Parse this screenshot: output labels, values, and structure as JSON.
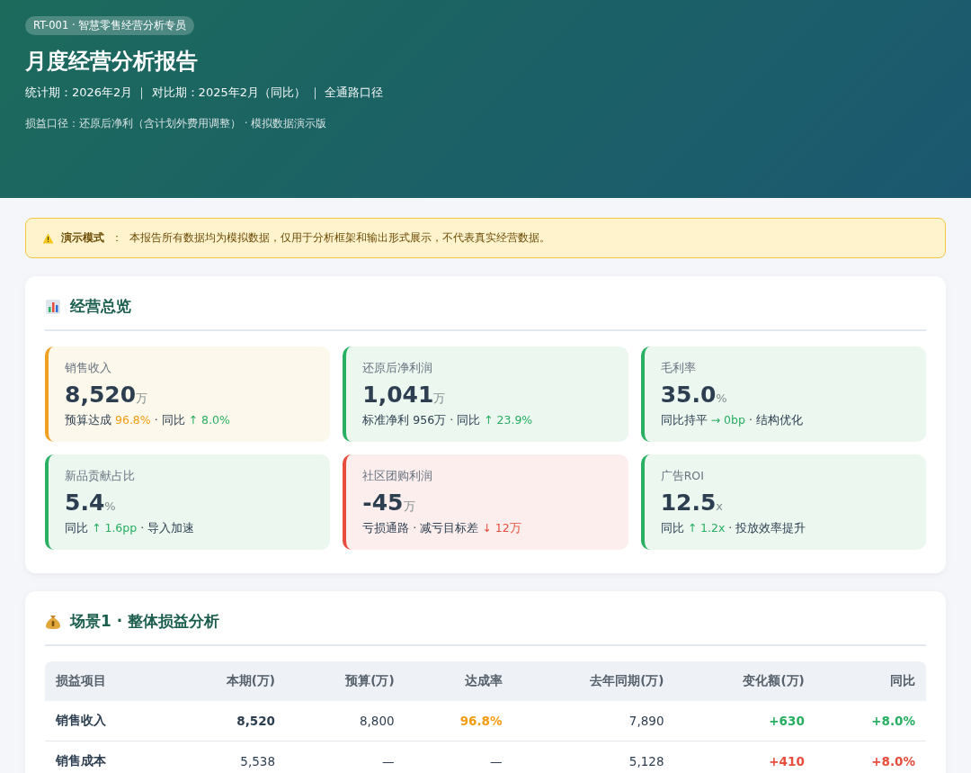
{
  "header": {
    "badge": "RT-001 · 智慧零售经营分析专员",
    "title": "月度经营分析报告",
    "meta": "统计期：2026年2月 ｜ 对比期：2025年2月（同比） ｜ 全通路口径",
    "note": "损益口径：还原后净利（含计划外费用调整） · 模拟数据演示版"
  },
  "notice": {
    "label": "演示模式",
    "separator": "：",
    "text": "本报告所有数据均为模拟数据，仅用于分析框架和输出形式展示，不代表真实经营数据。"
  },
  "overview": {
    "title": "经营总览",
    "cards": [
      {
        "kind": "warning",
        "label": "销售收入",
        "value": "8,520",
        "unit": "万",
        "sub": [
          {
            "text": "预算达成 ",
            "kind": "plain"
          },
          {
            "text": "96.8%",
            "kind": "warning"
          },
          {
            "text": " · 同比 ",
            "kind": "plain"
          },
          {
            "text": "↑ 8.0%",
            "kind": "positive"
          }
        ]
      },
      {
        "kind": "good",
        "label": "还原后净利润",
        "value": "1,041",
        "unit": "万",
        "sub": [
          {
            "text": "标准净利 956万 · 同比 ",
            "kind": "plain"
          },
          {
            "text": "↑ 23.9%",
            "kind": "positive"
          }
        ]
      },
      {
        "kind": "good",
        "label": "毛利率",
        "value": "35.0",
        "unit": "%",
        "sub": [
          {
            "text": "同比持平 ",
            "kind": "plain"
          },
          {
            "text": "→ 0bp",
            "kind": "positive"
          },
          {
            "text": " · 结构优化",
            "kind": "plain"
          }
        ]
      },
      {
        "kind": "good",
        "label": "新品贡献占比",
        "value": "5.4",
        "unit": "%",
        "sub": [
          {
            "text": "同比 ",
            "kind": "plain"
          },
          {
            "text": "↑ 1.6pp",
            "kind": "positive"
          },
          {
            "text": " · 导入加速",
            "kind": "plain"
          }
        ]
      },
      {
        "kind": "bad",
        "label": "社区团购利润",
        "value": "-45",
        "unit": "万",
        "sub": [
          {
            "text": "亏损通路 · 减亏目标差 ",
            "kind": "plain"
          },
          {
            "text": "↓ 12万",
            "kind": "negative"
          }
        ]
      },
      {
        "kind": "good",
        "label": "广告ROI",
        "value": "12.5",
        "unit": "x",
        "sub": [
          {
            "text": "同比 ",
            "kind": "plain"
          },
          {
            "text": "↑ 1.2x",
            "kind": "positive"
          },
          {
            "text": " · 投放效率提升",
            "kind": "plain"
          }
        ]
      }
    ]
  },
  "pnl": {
    "title": "场景1 · 整体损益分析",
    "table": {
      "columns": [
        "损益项目",
        "本期(万)",
        "预算(万)",
        "达成率",
        "去年同期(万)",
        "变化额(万)",
        "同比"
      ],
      "rows": [
        [
          {
            "text": "销售收入",
            "kind": "strong"
          },
          {
            "text": "8,520",
            "kind": "strong"
          },
          {
            "text": "8,800",
            "kind": "plain"
          },
          {
            "text": "96.8%",
            "kind": "warning"
          },
          {
            "text": "7,890",
            "kind": "plain"
          },
          {
            "text": "+630",
            "kind": "positive"
          },
          {
            "text": "+8.0%",
            "kind": "positive"
          }
        ],
        [
          {
            "text": "销售成本",
            "kind": "strong"
          },
          {
            "text": "5,538",
            "kind": "plain"
          },
          {
            "text": "—",
            "kind": "plain"
          },
          {
            "text": "—",
            "kind": "plain"
          },
          {
            "text": "5,128",
            "kind": "plain"
          },
          {
            "text": "+410",
            "kind": "negative"
          },
          {
            "text": "+8.0%",
            "kind": "negative"
          }
        ]
      ]
    }
  }
}
